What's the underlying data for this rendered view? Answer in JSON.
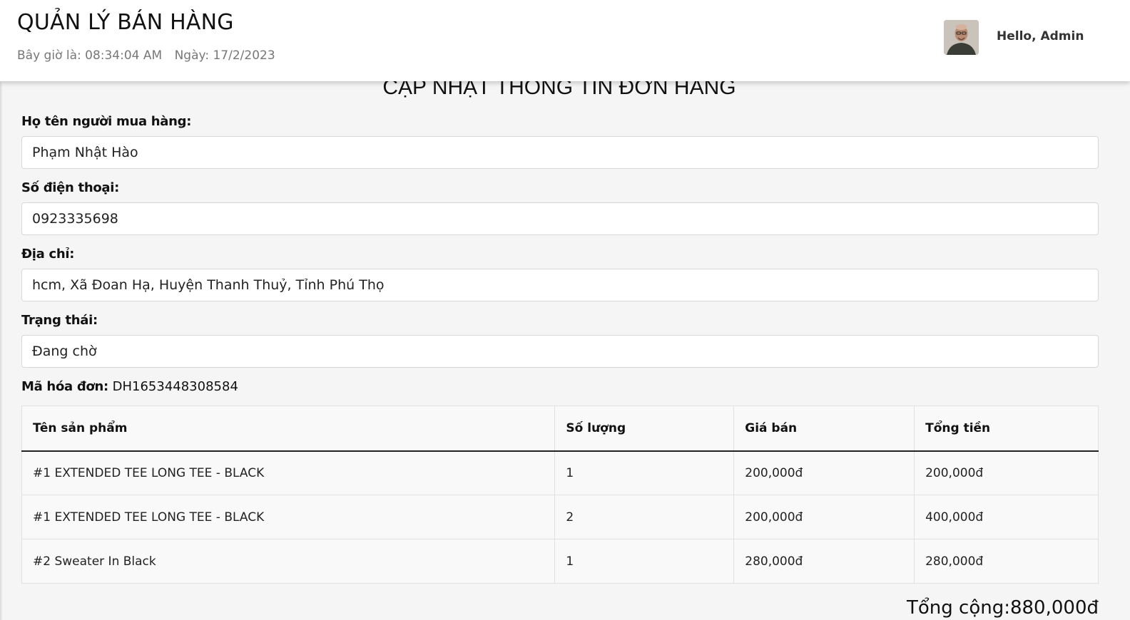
{
  "header": {
    "app_title": "QUẢN LÝ BÁN HÀNG",
    "current_time": "Bây giờ là: 08:34:04 AM",
    "current_date": "Ngày: 17/2/2023",
    "greeting": "Hello, Admin"
  },
  "main": {
    "page_heading": "CẬP NHẬT THÔNG TIN ĐƠN HÀNG",
    "fields": {
      "buyer_name": {
        "label": "Họ tên người mua hàng:",
        "value": "Phạm Nhật Hào"
      },
      "phone": {
        "label": "Số điện thoại:",
        "value": "0923335698"
      },
      "address": {
        "label": "Địa chỉ:",
        "value": "hcm, Xã Đoan Hạ, Huyện Thanh Thuỷ, Tỉnh Phú Thọ"
      },
      "status": {
        "label": "Trạng thái:",
        "value": "Đang chờ"
      }
    },
    "invoice_label": "Mã hóa đơn:",
    "invoice_code": "DH1653448308584",
    "table": {
      "headers": [
        "Tên sản phẩm",
        "Số lượng",
        "Giá bán",
        "Tổng tiền"
      ],
      "rows": [
        [
          "#1 EXTENDED TEE LONG TEE - BLACK",
          "1",
          "200,000đ",
          "200,000đ"
        ],
        [
          "#1 EXTENDED TEE LONG TEE - BLACK",
          "2",
          "200,000đ",
          "400,000đ"
        ],
        [
          "#2 Sweater In Black",
          "1",
          "280,000đ",
          "280,000đ"
        ]
      ]
    },
    "total": "Tổng cộng:880,000đ"
  }
}
